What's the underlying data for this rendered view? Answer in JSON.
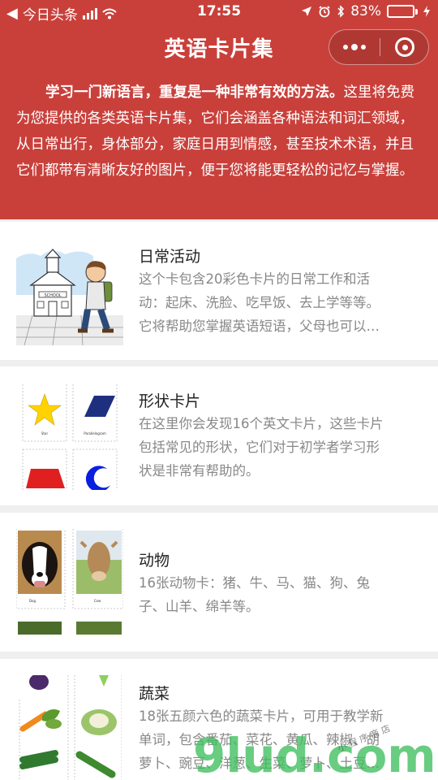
{
  "status_bar": {
    "carrier": "今日头条",
    "time": "17:55",
    "battery_percent": "83%",
    "battery_level": 0.83,
    "battery_color": "#63d95e",
    "icons": [
      "back-chevron-icon",
      "signal-icon",
      "wifi-icon",
      "location-icon",
      "alarm-icon",
      "bluetooth-icon",
      "battery-icon",
      "charging-icon"
    ]
  },
  "header": {
    "title": "英语卡片集",
    "background": "#c9403b",
    "capsule": {
      "more_icon": "more-dots-icon",
      "close_icon": "close-target-icon"
    }
  },
  "intro": {
    "bold_text": "学习一门新语言，重复是一种非常有效的方法。",
    "text": "这里将免费为您提供的各类英语卡片集，它们会涵盖各种语法和词汇领域，从日常出行，身体部分，家庭日用到情感，甚至技术术语，并且它们都带有清晰友好的图片，便于您将能更轻松的记忆与掌握。"
  },
  "cards": [
    {
      "title": "日常活动",
      "desc_lines": [
        "这个卡包含20彩色卡片的日常工作和活",
        "动：起床、洗脸、吃早饭、去上学等等。",
        "它将帮助您掌握英语短语，父母也可以…"
      ],
      "image": "school-boy-illustration",
      "image_text": "SCHOOL"
    },
    {
      "title": "形状卡片",
      "desc_lines": [
        "在这里你会发现16个英文卡片，这些卡片",
        "包括常见的形状，它们对于初学者学习形",
        "状是非常有帮助的。"
      ],
      "image": "shape-cards-illustration",
      "card_labels": [
        "Star",
        "Parallelogram"
      ]
    },
    {
      "title": "动物",
      "desc_lines": [
        "16张动物卡：猪、牛、马、猫、狗、兔",
        "子、山羊、绵羊等。"
      ],
      "image": "animal-cards-illustration",
      "card_labels": [
        "Dog",
        "Cow"
      ]
    },
    {
      "title": "蔬菜",
      "desc_lines": [
        "18张五颜六色的蔬菜卡片，可用于教学新",
        "单词，包含番茄、菜花、黄瓜、辣椒、胡",
        "萝卜、豌豆、洋葱、生菜、萝卜、土豆…"
      ],
      "image": "vegetable-cards-illustration"
    }
  ],
  "watermark": {
    "text": "9lud.com",
    "subtext": "小 程 序 商 店"
  }
}
